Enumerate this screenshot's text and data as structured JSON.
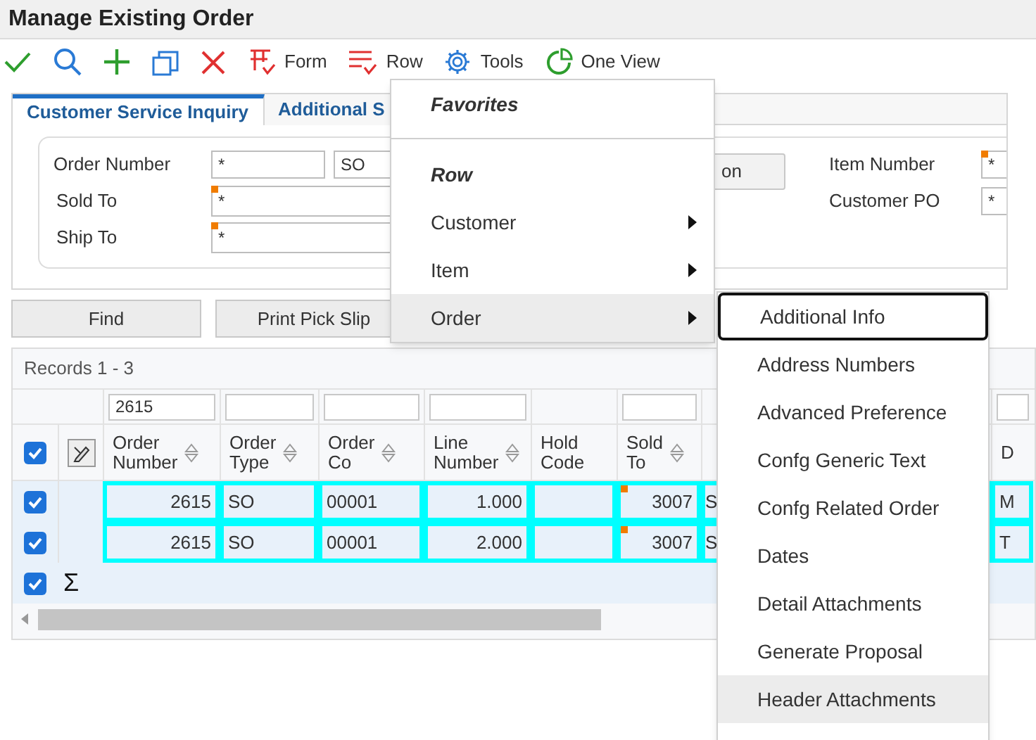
{
  "window": {
    "title": "Manage Existing Order"
  },
  "toolbar": [
    {
      "kind": "ok"
    },
    {
      "kind": "search"
    },
    {
      "kind": "add"
    },
    {
      "kind": "copy"
    },
    {
      "kind": "delete"
    },
    {
      "kind": "form",
      "label": "Form"
    },
    {
      "kind": "row",
      "label": "Row"
    },
    {
      "kind": "tools",
      "label": "Tools"
    },
    {
      "kind": "oneview",
      "label": "One View"
    }
  ],
  "tabs": [
    {
      "label": "Customer Service Inquiry",
      "selected": true
    },
    {
      "label": "Additional S",
      "selected": false
    }
  ],
  "form": {
    "left_fields": [
      {
        "label": "Order Number",
        "values": [
          "*",
          "SO"
        ],
        "flagged": false
      },
      {
        "label": "Sold To",
        "values": [
          "*"
        ],
        "flagged": true
      },
      {
        "label": "Ship To",
        "values": [
          "*"
        ],
        "flagged": true
      }
    ],
    "button": {
      "label": "on"
    },
    "right_fields": [
      {
        "label": "Item Number",
        "value": "*",
        "flagged": true
      },
      {
        "label": "Customer PO",
        "value": "*",
        "flagged": false
      }
    ]
  },
  "actions": [
    {
      "label": "Find"
    },
    {
      "label": "Print Pick Slip"
    }
  ],
  "grid": {
    "records": "Records 1 - 3",
    "header_checked": true,
    "columns": [
      {
        "header": "Order Number",
        "filter": "2615",
        "sortable": true
      },
      {
        "header": "Order Type",
        "filter_field": true,
        "sortable": true
      },
      {
        "header": "Order Co",
        "filter_field": true,
        "sortable": true
      },
      {
        "header": "Line Number",
        "filter_field": true,
        "sortable": true
      },
      {
        "header": "Hold Code",
        "filter_field": false,
        "sortable": false
      },
      {
        "header": "Sold To",
        "filter_field": true,
        "sortable": true
      },
      {
        "filter_field": false,
        "sortable": false
      },
      {
        "header": "D",
        "filter_field": true,
        "sortable": false
      }
    ],
    "rows": [
      {
        "checked": true,
        "selected": true,
        "cells": [
          "2615",
          "SO",
          "00001",
          "1.000",
          null,
          "3007",
          "S",
          "M"
        ]
      },
      {
        "checked": true,
        "selected": true,
        "cells": [
          "2615",
          "SO",
          "00001",
          "2.000",
          null,
          "3007",
          "S",
          "T"
        ]
      }
    ],
    "total_row": {
      "checked": true,
      "symbol": "Σ"
    }
  },
  "menu": {
    "sections": [
      {
        "heading": "Favorites"
      },
      {
        "heading": "Row",
        "items": [
          {
            "label": "Customer",
            "has_submenu": true,
            "highlighted": false
          },
          {
            "label": "Item",
            "has_submenu": true,
            "highlighted": false
          },
          {
            "label": "Order",
            "has_submenu": true,
            "highlighted": true
          }
        ]
      }
    ]
  },
  "submenu": [
    {
      "label": "Additional Info",
      "focused": true,
      "highlighted": false
    },
    {
      "label": "Address Numbers",
      "focused": false,
      "highlighted": false
    },
    {
      "label": "Advanced Preference",
      "focused": false,
      "highlighted": false
    },
    {
      "label": "Confg Generic Text",
      "focused": false,
      "highlighted": false
    },
    {
      "label": "Confg Related Order",
      "focused": false,
      "highlighted": false
    },
    {
      "label": "Dates",
      "focused": false,
      "highlighted": false
    },
    {
      "label": "Detail Attachments",
      "focused": false,
      "highlighted": false
    },
    {
      "label": "Generate Proposal",
      "focused": false,
      "highlighted": false
    },
    {
      "label": "Header Attachments",
      "focused": false,
      "highlighted": true
    }
  ]
}
